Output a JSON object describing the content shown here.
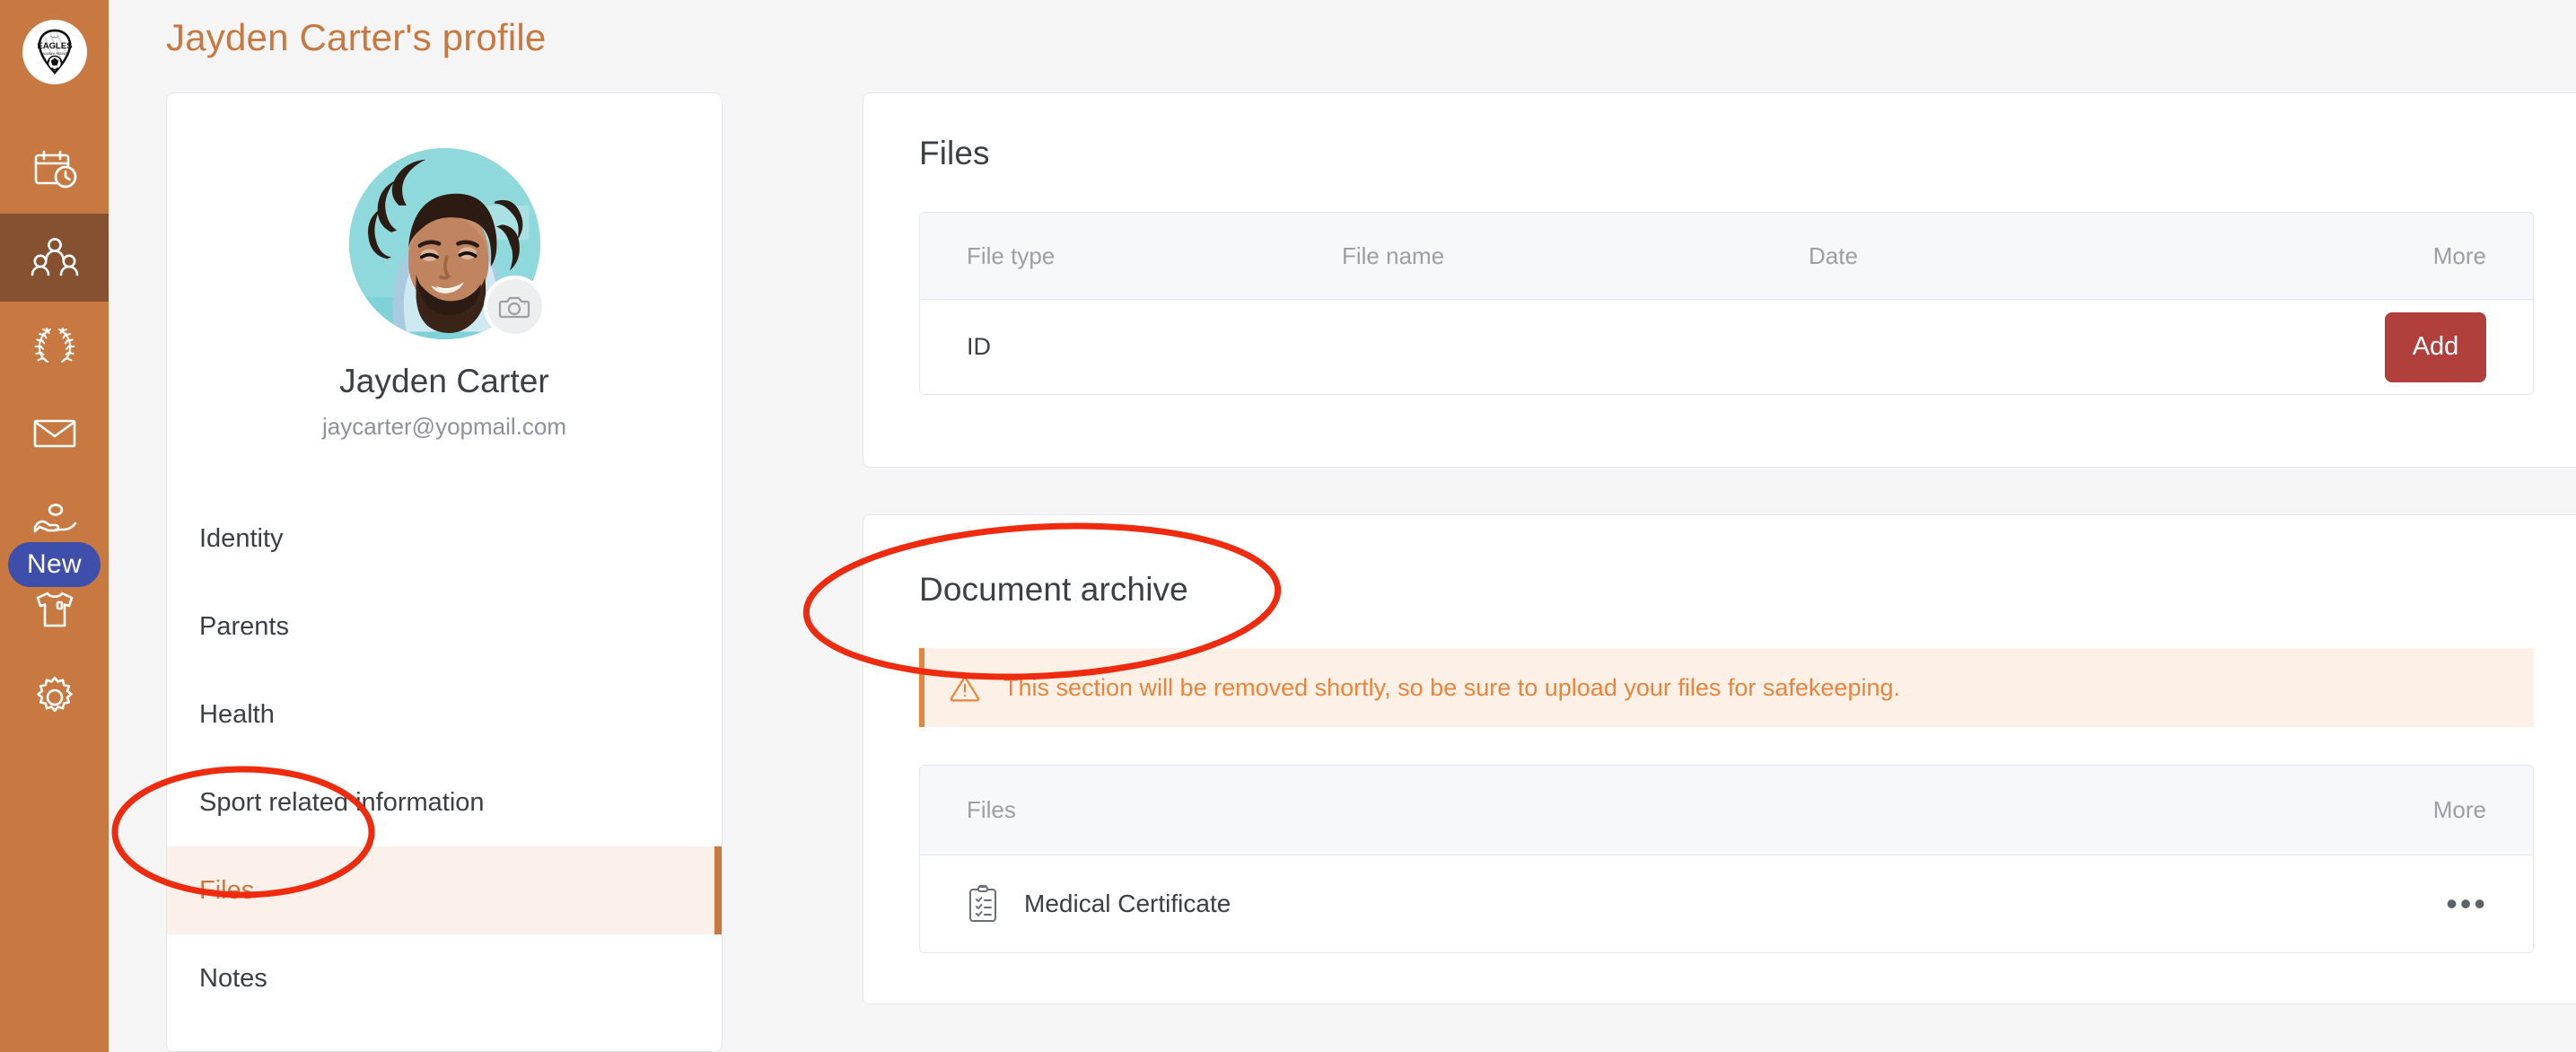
{
  "header": {
    "title": "Jayden Carter's profile",
    "accent_color": "#c87941"
  },
  "sidebar": {
    "background_color": "#c87941",
    "active_background_color": "#855130",
    "logo": {
      "name": "eagles-club-logo",
      "text": "EAGLES",
      "subtext": "ALWAYS RISING"
    },
    "items": [
      {
        "icon": "calendar-clock-icon",
        "label": "Schedule",
        "active": false
      },
      {
        "icon": "people-group-icon",
        "label": "Members",
        "active": true
      },
      {
        "icon": "laurel-wreath-icon",
        "label": "Competitions",
        "active": false
      },
      {
        "icon": "envelope-icon",
        "label": "Messages",
        "active": false
      },
      {
        "icon": "hand-coin-icon",
        "label": "Donations",
        "active": false,
        "badge": "New"
      },
      {
        "icon": "tshirt-icon",
        "label": "Kit",
        "active": false
      },
      {
        "icon": "gear-icon",
        "label": "Settings",
        "active": false
      }
    ],
    "badge_label": "New",
    "badge_color": "#3d4eab"
  },
  "profile": {
    "name": "Jayden Carter",
    "email": "jaycarter@yopmail.com",
    "avatar_name": "profile-photo",
    "camera_icon": "camera-icon",
    "nav": [
      {
        "label": "Identity",
        "active": false
      },
      {
        "label": "Parents",
        "active": false
      },
      {
        "label": "Health",
        "active": false
      },
      {
        "label": "Sport related information",
        "active": false
      },
      {
        "label": "Files",
        "active": true
      },
      {
        "label": "Notes",
        "active": false
      }
    ]
  },
  "files_card": {
    "title": "Files",
    "columns": {
      "file_type": "File type",
      "file_name": "File name",
      "date": "Date",
      "more": "More"
    },
    "rows": [
      {
        "file_type": "ID",
        "file_name": "",
        "date": "",
        "action_label": "Add"
      }
    ],
    "add_button_color": "#b1403c"
  },
  "archive_card": {
    "title": "Document archive",
    "alert": {
      "icon": "warning-triangle-icon",
      "message": "This section will be removed shortly, so be sure to upload your files for safekeeping.",
      "color": "#e8853c",
      "background_color": "#fdf0e7"
    },
    "columns": {
      "files": "Files",
      "more": "More"
    },
    "rows": [
      {
        "icon": "clipboard-checklist-icon",
        "name": "Medical Certificate",
        "more_icon": "ellipsis-icon"
      }
    ]
  },
  "annotations": {
    "color": "#ee2b0f",
    "shapes": [
      {
        "name": "annotation-ellipse-files-nav",
        "target": "Files"
      },
      {
        "name": "annotation-ellipse-document-archive",
        "target": "Document archive"
      }
    ]
  }
}
